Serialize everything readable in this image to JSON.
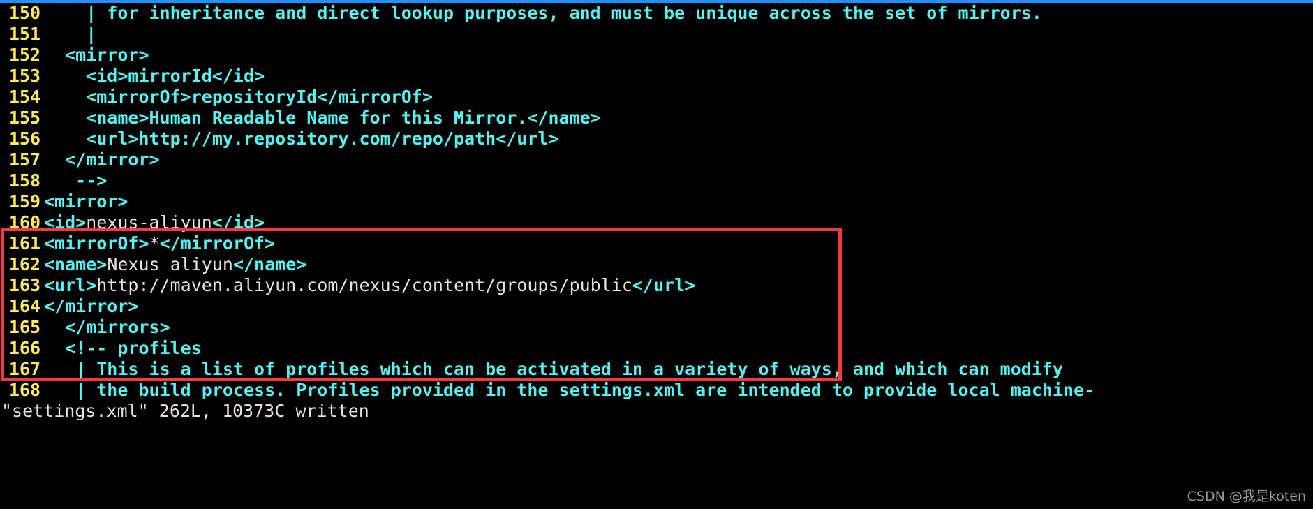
{
  "window": {
    "top_border_color": "#1e90ff",
    "background_color": "#000000"
  },
  "editor": {
    "line_number_color": "#ffec4a",
    "tag_color": "#4ff5f5",
    "text_color": "#e8e2da",
    "lines": [
      {
        "num": "150",
        "segments": [
          {
            "t": "    | for inheritance and direct lookup purposes, and must be unique across the set of mirrors.",
            "c": "cmt"
          }
        ]
      },
      {
        "num": "151",
        "segments": [
          {
            "t": "    |",
            "c": "cmt"
          }
        ]
      },
      {
        "num": "152",
        "segments": [
          {
            "t": "  <mirror>",
            "c": "tag"
          }
        ]
      },
      {
        "num": "153",
        "segments": [
          {
            "t": "    <id>mirrorId</id>",
            "c": "tag"
          }
        ]
      },
      {
        "num": "154",
        "segments": [
          {
            "t": "    <mirrorOf>repositoryId</mirrorOf>",
            "c": "tag"
          }
        ]
      },
      {
        "num": "155",
        "segments": [
          {
            "t": "    <name>Human Readable Name for this Mirror.</name>",
            "c": "tag"
          }
        ]
      },
      {
        "num": "156",
        "segments": [
          {
            "t": "    <url>http://my.repository.com/repo/path</url>",
            "c": "tag"
          }
        ]
      },
      {
        "num": "157",
        "segments": [
          {
            "t": "  </mirror>",
            "c": "tag"
          }
        ]
      },
      {
        "num": "158",
        "segments": [
          {
            "t": "   -->",
            "c": "cmt"
          }
        ]
      },
      {
        "num": "159",
        "segments": [
          {
            "t": "<mirror>",
            "c": "tag"
          }
        ]
      },
      {
        "num": "160",
        "segments": [
          {
            "t": "<id>",
            "c": "tag"
          },
          {
            "t": "nexus-aliyun",
            "c": "val"
          },
          {
            "t": "</id>",
            "c": "tag"
          }
        ]
      },
      {
        "num": "161",
        "segments": [
          {
            "t": "<mirrorOf>",
            "c": "tag"
          },
          {
            "t": "*",
            "c": "val"
          },
          {
            "t": "</mirrorOf>",
            "c": "tag"
          }
        ]
      },
      {
        "num": "162",
        "segments": [
          {
            "t": "<name>",
            "c": "tag"
          },
          {
            "t": "Nexus aliyun",
            "c": "val"
          },
          {
            "t": "</name>",
            "c": "tag"
          }
        ]
      },
      {
        "num": "163",
        "segments": [
          {
            "t": "<url>",
            "c": "tag"
          },
          {
            "t": "http://maven.aliyun.com/nexus/content/groups/public",
            "c": "val"
          },
          {
            "t": "</url>",
            "c": "tag"
          }
        ]
      },
      {
        "num": "164",
        "segments": [
          {
            "t": "</mirror>",
            "c": "tag"
          }
        ]
      },
      {
        "num": "165",
        "segments": [
          {
            "t": "  </mirrors>",
            "c": "tag"
          }
        ]
      },
      {
        "num": "166",
        "segments": [
          {
            "t": "  <!-- profiles",
            "c": "cmt"
          }
        ]
      },
      {
        "num": "167",
        "segments": [
          {
            "t": "   | This is a list of profiles which can be activated in a variety of ways, and which can modify",
            "c": "cmt"
          }
        ]
      },
      {
        "num": "168",
        "segments": [
          {
            "t": "   | the build process. Profiles provided in the settings.xml are intended to provide local machine-",
            "c": "cmt"
          }
        ]
      }
    ]
  },
  "highlight": {
    "color": "#f7393a",
    "covers_lines": [
      "159",
      "160",
      "161",
      "162",
      "163",
      "164"
    ]
  },
  "status": {
    "text": "\"settings.xml\" 262L, 10373C written",
    "filename": "settings.xml",
    "line_count": "262L",
    "char_count": "10373C",
    "action": "written"
  },
  "watermark": {
    "text": "CSDN @我是koten"
  }
}
